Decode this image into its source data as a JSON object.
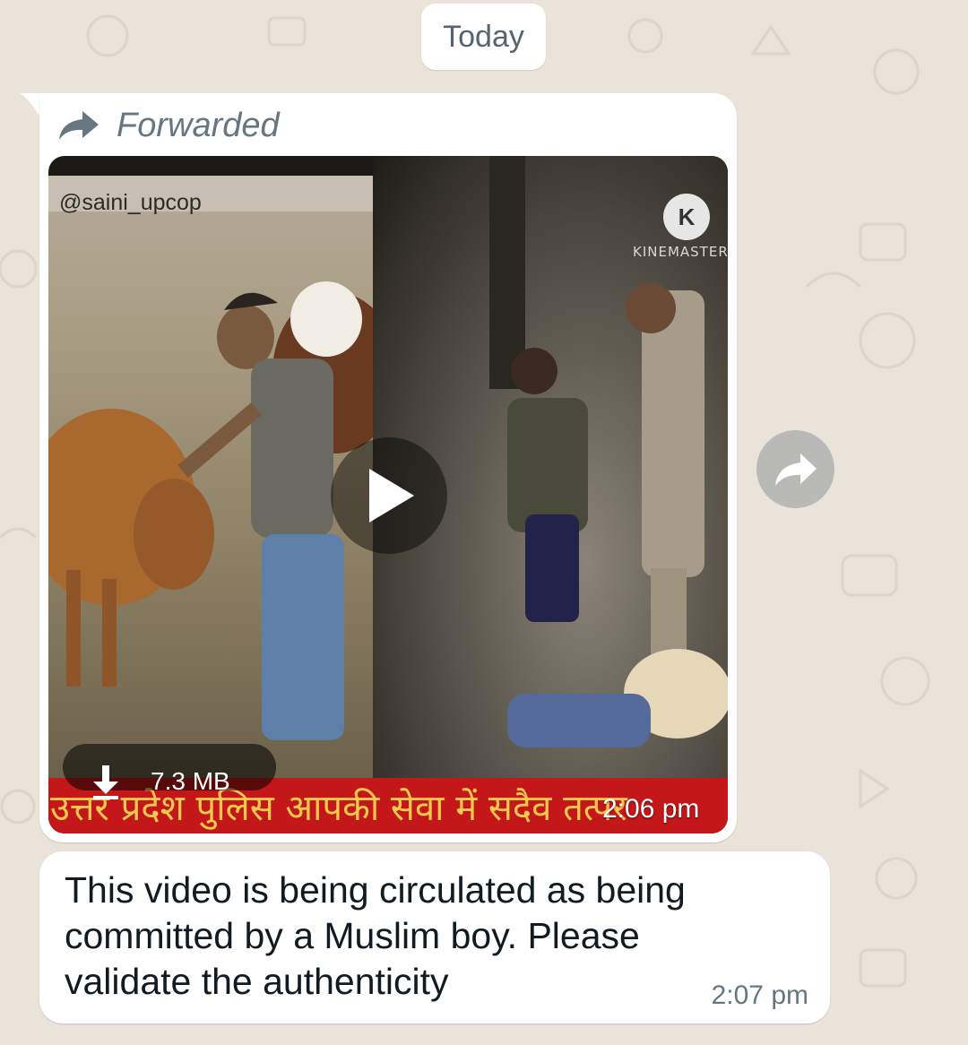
{
  "chat": {
    "date_separator": "Today"
  },
  "media_message": {
    "forwarded_label": "Forwarded",
    "video": {
      "overlay_handle": "@saini_upcop",
      "watermark_logo_letter": "K",
      "watermark_text": "KINEMASTER",
      "banner_text": "उत्तर प्रदेश पुलिस आपकी सेवा में सदैव तत्पर",
      "file_size": "7.3 MB",
      "play_icon": "play-icon",
      "download_icon": "download-icon"
    },
    "time": "2:06 pm",
    "share_icon": "forward-share-icon"
  },
  "text_message": {
    "text": "This video is being circulated as being committed by a Muslim boy. Please validate the authenticity",
    "time": "2:07 pm"
  },
  "colors": {
    "wallpaper": "#e9e3da",
    "bubble": "#ffffff",
    "meta_text": "#667781",
    "banner_red": "#c4171a",
    "banner_text": "#f2c94c"
  }
}
